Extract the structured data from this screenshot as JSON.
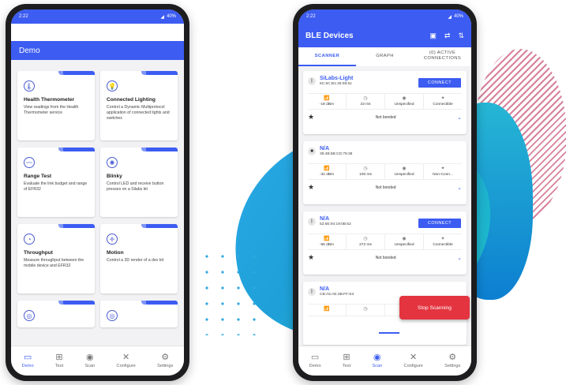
{
  "phone_left": {
    "status_time": "2:22",
    "status_battery": "40%",
    "app_title": "Demo",
    "cards": [
      {
        "title": "Health Thermometer",
        "desc": "View readings from the Health Thermometer service",
        "icon": "thermometer-icon",
        "glyph": "🌡"
      },
      {
        "title": "Connected Lighting",
        "desc": "Control a Dynamic Multiprotocol application of connected lights and switches",
        "icon": "bulb-icon",
        "glyph": "💡"
      },
      {
        "title": "Range Test",
        "desc": "Evaluate the link budget and range of EFR32",
        "icon": "range-icon",
        "glyph": "〰"
      },
      {
        "title": "Blinky",
        "desc": "Control LED and receive button presses on a Silabs kit",
        "icon": "led-icon",
        "glyph": "✺"
      },
      {
        "title": "Throughput",
        "desc": "Measure throughput between the mobile device and EFR32",
        "icon": "gauge-icon",
        "glyph": "◔"
      },
      {
        "title": "Motion",
        "desc": "Control a 3D render of a dev kit",
        "icon": "motion-icon",
        "glyph": "✛"
      }
    ],
    "nav": [
      {
        "label": "Demo",
        "glyph": "▭",
        "active": true
      },
      {
        "label": "Test",
        "glyph": "⊞",
        "active": false
      },
      {
        "label": "Scan",
        "glyph": "◉",
        "active": false
      },
      {
        "label": "Configure",
        "glyph": "✕",
        "active": false
      },
      {
        "label": "Settings",
        "glyph": "⚙",
        "active": false
      }
    ]
  },
  "phone_right": {
    "status_time": "2:22",
    "status_battery": "40%",
    "app_title": "BLE Devices",
    "tabs": [
      "SCANNER",
      "GRAPH",
      "(0) ACTIVE CONNECTIONS"
    ],
    "connect_label": "CONNECT",
    "bond_label": "Not bonded",
    "devices": [
      {
        "name": "SiLabs-Light",
        "mac": "6C:5C:B1:45:08:51",
        "rssi": "-18 dBm",
        "interval": "23 ms",
        "type": "Unspecified",
        "conn": "Connectible",
        "connect": true
      },
      {
        "name": "N/A",
        "mac": "39:4B:6B:CD:79:38",
        "rssi": "-32 dBm",
        "interval": "100 ms",
        "type": "Unspecified",
        "conn": "Non-Conn...",
        "connect": false
      },
      {
        "name": "N/A",
        "mac": "52:6E:94:19:0B:52",
        "rssi": "-56 dBm",
        "interval": "272 ms",
        "type": "Unspecified",
        "conn": "Connectible",
        "connect": true
      },
      {
        "name": "N/A",
        "mac": "CB:A5:AE:3B:FF:E3",
        "rssi": "",
        "interval": "",
        "type": "",
        "conn": "",
        "connect": false
      }
    ],
    "stop_label": "Stop Scanning",
    "nav": [
      {
        "label": "Demo",
        "glyph": "▭",
        "active": false
      },
      {
        "label": "Test",
        "glyph": "⊞",
        "active": false
      },
      {
        "label": "Scan",
        "glyph": "◉",
        "active": true
      },
      {
        "label": "Configure",
        "glyph": "✕",
        "active": false
      },
      {
        "label": "Settings",
        "glyph": "⚙",
        "active": false
      }
    ]
  },
  "colors": {
    "accent": "#3c5cf2",
    "stop": "#e3343f",
    "teal": "#1fa0d8",
    "stripe": "#d06b8a"
  }
}
